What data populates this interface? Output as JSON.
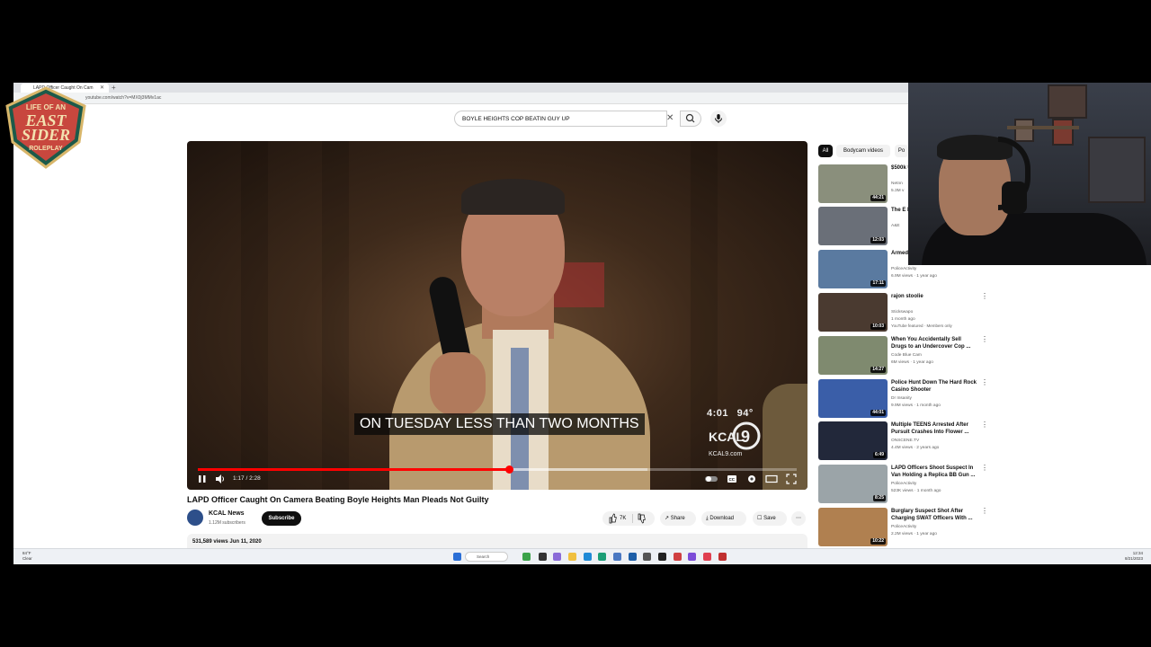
{
  "browser": {
    "tab_title": "LAPD Officer Caught On Cam",
    "url": "youtube.com/watch?v=MX0j3MMv1ac"
  },
  "overlay_logo": {
    "line1": "LIFE OF AN",
    "line2": "EAST",
    "line3": "SIDER",
    "line4": "ROLEPLAY"
  },
  "search": {
    "query": "BOYLE HEIGHTS COP BEATIN GUY UP"
  },
  "player": {
    "caption": "ON TUESDAY LESS THAN TWO MONTHS",
    "time_current": "1:17",
    "time_total": "2:28",
    "time_display": "1:17 / 2:28",
    "progress_fraction": 0.52,
    "buffered_fraction": 0.75,
    "station_time": "4:01",
    "station_temp": "94°",
    "station_logo": "KCAL 9",
    "station_site": "KCAL9.com"
  },
  "video": {
    "title": "LAPD Officer Caught On Camera Beating Boyle Heights Man Pleads Not Guilty",
    "channel": "KCAL News",
    "subscribers": "1.12M subscribers",
    "subscribe_label": "Subscribe",
    "likes": "7K",
    "share_label": "Share",
    "download_label": "Download",
    "save_label": "Save",
    "views_date": "531,589 views  Jun 11, 2020"
  },
  "chips": [
    "All",
    "Bodycam videos",
    "Po"
  ],
  "recommendations": [
    {
      "title": "$500k Unco",
      "channel": "Netnn",
      "views": "5.3M v",
      "duration": "44:21",
      "color": "#8a8f7c"
    },
    {
      "title": "The E Fight",
      "channel": "A&E",
      "views": "",
      "duration": "12:03",
      "color": "#6a6f78"
    },
    {
      "title": "Armed Pasad",
      "channel": "PoliceActivity",
      "views": "6.9M views · 1 year ago",
      "duration": "17:11",
      "color": "#5a7aa0"
    },
    {
      "title": "rajon stoolie",
      "channel": "Stickswapo",
      "views": "1 month ago",
      "badge": "YouTube featured  ·  Members only",
      "duration": "10:03",
      "color": "#4a3a30"
    },
    {
      "title": "When You Accidentally Sell Drugs to an Undercover Cop ...",
      "channel": "Code Blue Cam",
      "views": "6M views · 1 year ago",
      "duration": "14:27",
      "color": "#7f8a6f"
    },
    {
      "title": "Police Hunt Down The Hard Rock Casino Shooter",
      "channel": "Dr Insanity",
      "views": "9.9M views · 1 month ago",
      "duration": "44:01",
      "color": "#3a5ea8"
    },
    {
      "title": "Multiple TEENS Arrested After Pursuit Crashes Into Flower ...",
      "channel": "ONSCENE.TV",
      "views": "4.4M views · 2 years ago",
      "duration": "6:49",
      "color": "#22283a"
    },
    {
      "title": "LAPD Officers Shoot Suspect In Van Holding a Replica BB Gun ...",
      "channel": "PoliceActivity",
      "views": "523K views · 1 month ago",
      "duration": "8:25",
      "color": "#9ba4a8"
    },
    {
      "title": "Burglary Suspect Shot After Charging SWAT Officers With ...",
      "channel": "PoliceActivity",
      "views": "2.2M views · 1 year ago",
      "duration": "10:22",
      "color": "#b08050"
    }
  ],
  "taskbar": {
    "weather_temp": "84°F",
    "weather_desc": "Clear",
    "search_label": "Search",
    "time": "12:34",
    "date": "8/21/2023"
  }
}
